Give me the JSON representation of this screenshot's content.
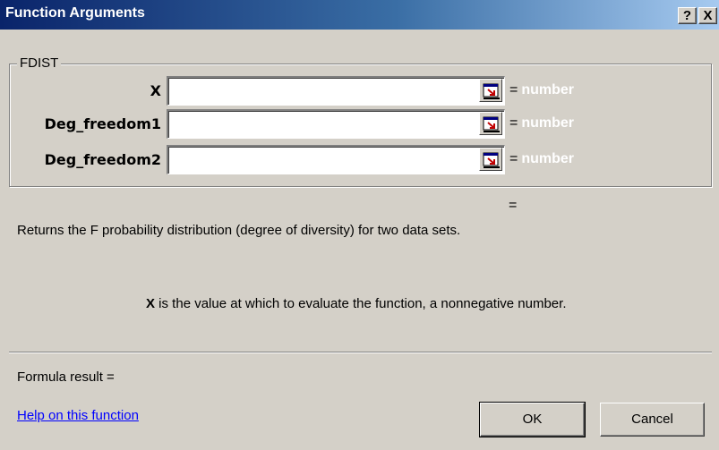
{
  "window": {
    "title": "Function Arguments",
    "help_button": "?",
    "close_button": "X"
  },
  "function": {
    "name": "FDIST",
    "arguments": [
      {
        "label": "X",
        "value": "",
        "result_sign": "=",
        "hint": "number"
      },
      {
        "label": "Deg_freedom1",
        "value": "",
        "result_sign": "=",
        "hint": "number"
      },
      {
        "label": "Deg_freedom2",
        "value": "",
        "result_sign": "=",
        "hint": "number"
      }
    ],
    "result_sign": "=",
    "description": "Returns the F probability distribution (degree of diversity) for two data sets.",
    "arg_description_name": "X",
    "arg_description_text": " is the value at which to evaluate the function, a nonnegative number."
  },
  "footer": {
    "formula_result": "Formula result =",
    "help_link": "Help on this function",
    "ok_label": "OK",
    "cancel_label": "Cancel"
  },
  "colors": {
    "title_gradient_start": "#0a246a",
    "title_gradient_end": "#a6caf0",
    "dialog_face": "#d4d0c8",
    "link": "#0000ff"
  }
}
